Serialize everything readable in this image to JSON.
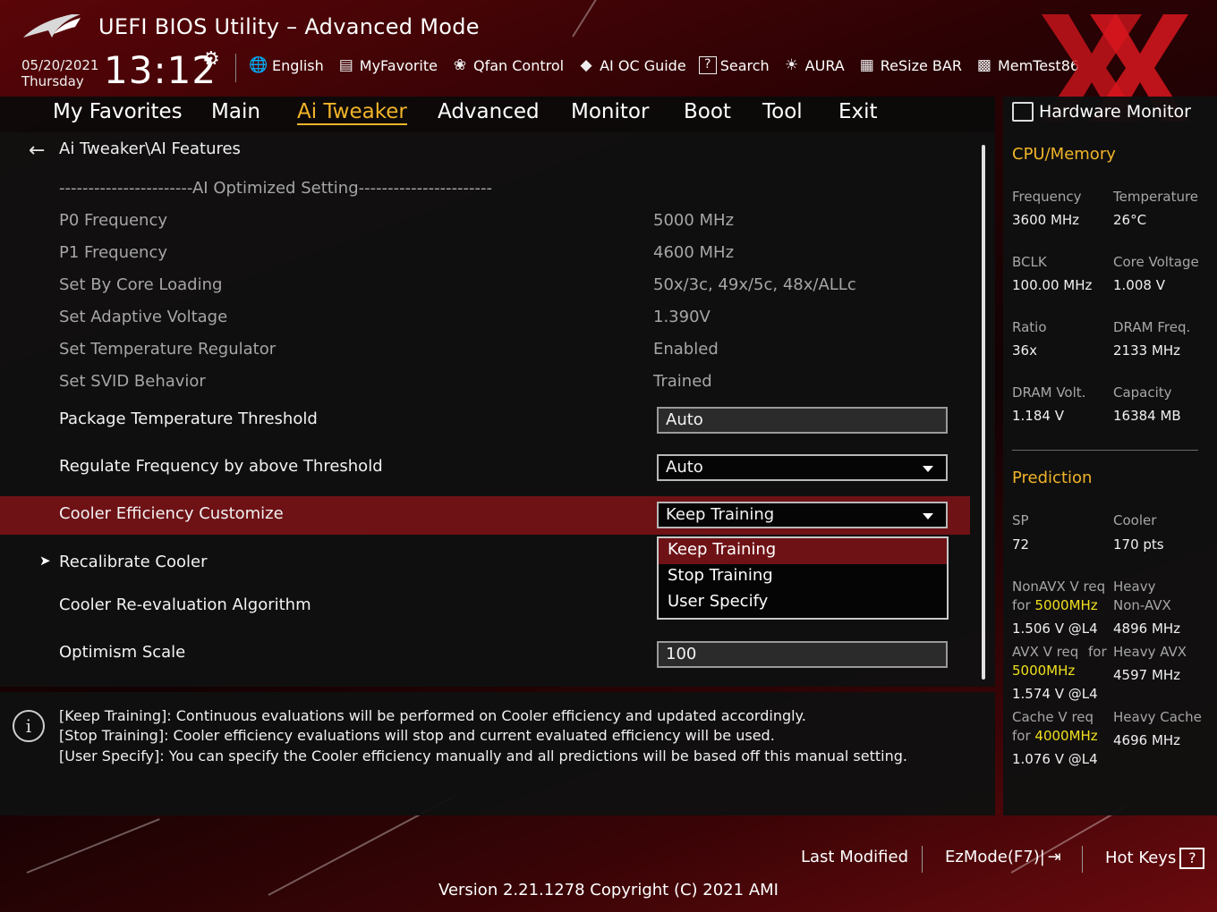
{
  "header": {
    "title": "UEFI BIOS Utility – Advanced Mode",
    "date": "05/20/2021",
    "day": "Thursday",
    "time": "13:12",
    "toolbar": [
      {
        "label": "English",
        "icon": "globe-icon"
      },
      {
        "label": "MyFavorite",
        "icon": "favorite-icon"
      },
      {
        "label": "Qfan Control",
        "icon": "fan-icon"
      },
      {
        "label": "AI OC Guide",
        "icon": "ai-chip-icon"
      },
      {
        "label": "Search",
        "icon": "search-help-icon"
      },
      {
        "label": "AURA",
        "icon": "aura-light-icon"
      },
      {
        "label": "ReSize BAR",
        "icon": "resize-bar-icon"
      },
      {
        "label": "MemTest86",
        "icon": "memtest-icon"
      }
    ]
  },
  "nav": {
    "tabs": [
      "My Favorites",
      "Main",
      "Ai Tweaker",
      "Advanced",
      "Monitor",
      "Boot",
      "Tool",
      "Exit"
    ],
    "active": "Ai Tweaker"
  },
  "main": {
    "breadcrumb": "Ai Tweaker\\AI Features",
    "section_header": "-----------------------AI Optimized Setting-----------------------",
    "readonly_rows": [
      {
        "label": "P0 Frequency",
        "value": "5000 MHz"
      },
      {
        "label": "P1 Frequency",
        "value": "4600 MHz"
      },
      {
        "label": "Set By Core Loading",
        "value": "50x/3c, 49x/5c, 48x/ALLc"
      },
      {
        "label": "Set Adaptive Voltage",
        "value": "1.390V"
      },
      {
        "label": "Set Temperature Regulator",
        "value": "Enabled"
      },
      {
        "label": "Set SVID Behavior",
        "value": "Trained"
      }
    ],
    "package_temp": {
      "label": "Package Temperature Threshold",
      "value": "Auto"
    },
    "regulate_freq": {
      "label": "Regulate Frequency by above Threshold",
      "value": "Auto"
    },
    "cooler_eff": {
      "label": "Cooler Efficiency Customize",
      "value": "Keep Training"
    },
    "recalibrate": {
      "label": "Recalibrate Cooler"
    },
    "reeval": {
      "label": "Cooler Re-evaluation Algorithm"
    },
    "optimism": {
      "label": "Optimism Scale",
      "value": "100"
    },
    "dropdown_options": [
      "Keep Training",
      "Stop Training",
      "User Specify"
    ]
  },
  "help": {
    "lines": [
      "[Keep Training]: Continuous evaluations will be performed on Cooler efficiency and updated accordingly.",
      "[Stop Training]: Cooler efficiency evaluations will stop and current evaluated efficiency will be used.",
      "[User Specify]: You can specify the Cooler efficiency manually and all predictions will be based off this manual setting."
    ]
  },
  "hwmon": {
    "title": "Hardware Monitor",
    "cpu_mem": {
      "title": "CPU/Memory",
      "frequency_label": "Frequency",
      "frequency": "3600 MHz",
      "temperature_label": "Temperature",
      "temperature": "26°C",
      "bclk_label": "BCLK",
      "bclk": "100.00 MHz",
      "core_voltage_label": "Core Voltage",
      "core_voltage": "1.008 V",
      "ratio_label": "Ratio",
      "ratio": "36x",
      "dram_freq_label": "DRAM Freq.",
      "dram_freq": "2133 MHz",
      "dram_volt_label": "DRAM Volt.",
      "dram_volt": "1.184 V",
      "capacity_label": "Capacity",
      "capacity": "16384 MB"
    },
    "prediction": {
      "title": "Prediction",
      "sp_label": "SP",
      "sp": "72",
      "cooler_label": "Cooler",
      "cooler": "170 pts",
      "nonavx_label": "NonAVX V req",
      "for_label": "for",
      "nonavx_freq": "5000MHz",
      "nonavx_v": "1.506 V @L4",
      "heavy_label": "Heavy",
      "nonavx_word": "Non-AVX",
      "heavy_nonavx": "4896 MHz",
      "avx_label": "AVX V req",
      "for2_label": "for",
      "avx_freq": "5000MHz",
      "avx_v": "1.574 V @L4",
      "heavy_avx_label": "Heavy AVX",
      "heavy_avx": "4597 MHz",
      "cache_label": "Cache V req",
      "for3_label": "for",
      "cache_freq": "4000MHz",
      "cache_v": "1.076 V @L4",
      "heavy_cache_label": "Heavy Cache",
      "heavy_cache": "4696 MHz"
    }
  },
  "footer": {
    "last_modified": "Last Modified",
    "ezmode": "EzMode(F7)|",
    "ezmode_icon": "exit-arrow-icon",
    "hot_keys": "Hot Keys",
    "hot_keys_icon": "?",
    "version": "Version 2.21.1278 Copyright (C) 2021 AMI"
  },
  "colors": {
    "accent": "#f0b429",
    "highlight_row": "#6e1216",
    "yellow_freq": "#f0e020"
  }
}
